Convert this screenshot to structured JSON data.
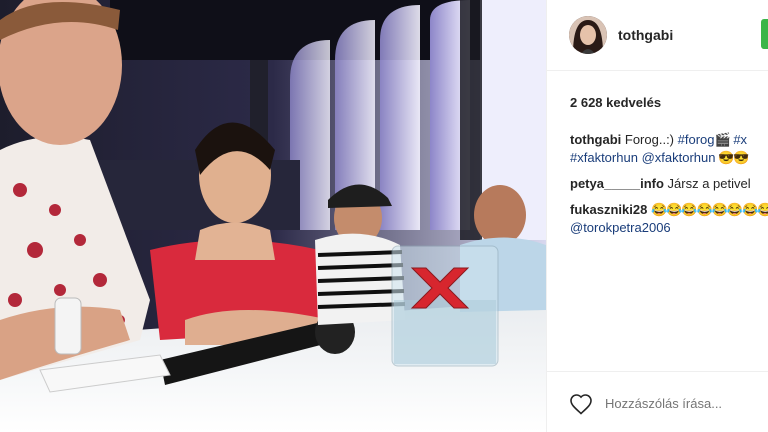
{
  "post": {
    "username": "tothgabi",
    "likes": "2 628 kedvelés",
    "comments": [
      {
        "user": "tothgabi",
        "lines": [
          [
            {
              "t": "text",
              "v": "Forog..:) "
            },
            {
              "t": "tag",
              "v": "#forog"
            },
            {
              "t": "emoji",
              "v": "🎬"
            },
            {
              "t": "tag",
              "v": " #x"
            }
          ],
          [
            {
              "t": "tag",
              "v": "#xfaktorhun"
            },
            {
              "t": "text",
              "v": " "
            },
            {
              "t": "tag",
              "v": "@xfaktorhun"
            },
            {
              "t": "emoji",
              "v": " 😎😎"
            }
          ]
        ]
      },
      {
        "user": "petya_____info",
        "lines": [
          [
            {
              "t": "text",
              "v": "Jársz a petivel"
            }
          ]
        ]
      },
      {
        "user": "fukaszniki28",
        "lines": [
          [
            {
              "t": "emoji",
              "v": "😂😂😂😂😂😂😂😂"
            }
          ],
          [
            {
              "t": "tag",
              "v": "@torokpetra2006"
            }
          ]
        ]
      }
    ],
    "comment_placeholder": "Hozzászólás írása..."
  },
  "icons": {
    "like": "heart-icon",
    "avatar": "avatar"
  },
  "colors": {
    "hashtag": "#1a3d7a",
    "follow": "#3bb548"
  }
}
